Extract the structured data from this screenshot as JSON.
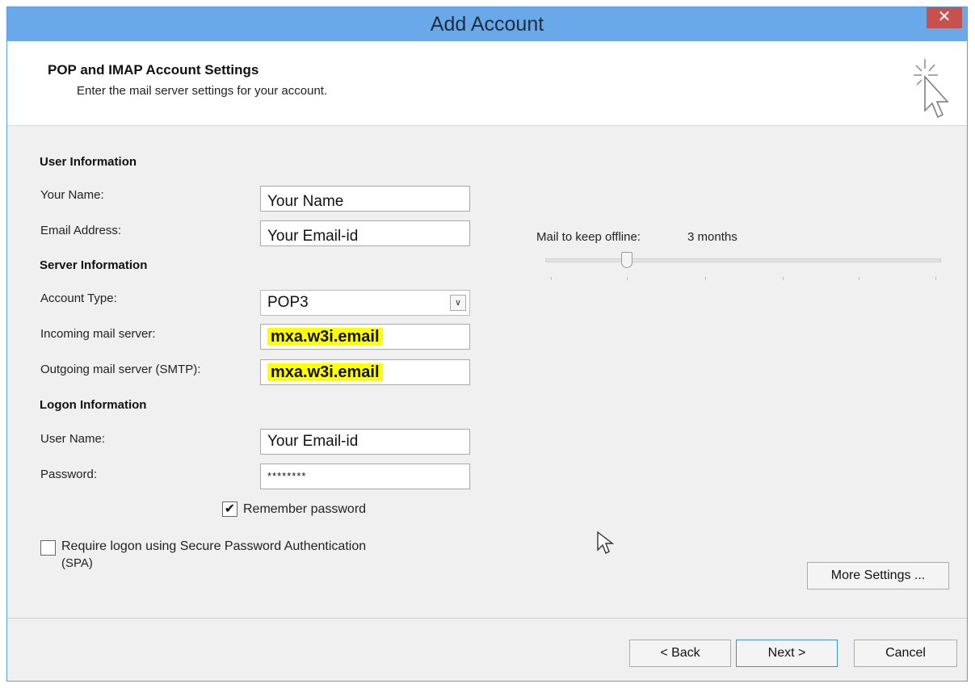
{
  "window": {
    "title": "Add Account",
    "close_glyph": "✕"
  },
  "header": {
    "title": "POP and IMAP Account Settings",
    "subtitle": "Enter the mail server settings for your account.",
    "icon": "sparkle-cursor-icon"
  },
  "user_info": {
    "heading": "User Information",
    "name_label": "Your Name:",
    "name_value": "Your Name",
    "email_label": "Email Address:",
    "email_value": "Your Email-id"
  },
  "server_info": {
    "heading": "Server Information",
    "account_type_label": "Account Type:",
    "account_type_value": "POP3",
    "incoming_label": "Incoming mail server:",
    "incoming_value": "mxa.w3i.email",
    "outgoing_label": "Outgoing mail server (SMTP):",
    "outgoing_value": "mxa.w3i.email",
    "highlight_color": "#ffff00"
  },
  "logon_info": {
    "heading": "Logon Information",
    "username_label": "User Name:",
    "username_value": "Your Email-id",
    "password_label": "Password:",
    "password_value": "********",
    "remember_label": "Remember password",
    "remember_checked": true,
    "spa_label_line1": "Require logon using Secure Password Authentication",
    "spa_label_line2": "(SPA)",
    "spa_checked": false
  },
  "offline": {
    "label": "Mail to keep offline:",
    "value": "3 months"
  },
  "buttons": {
    "more_settings": "More Settings ...",
    "back": "< Back",
    "next": "Next >",
    "cancel": "Cancel"
  }
}
